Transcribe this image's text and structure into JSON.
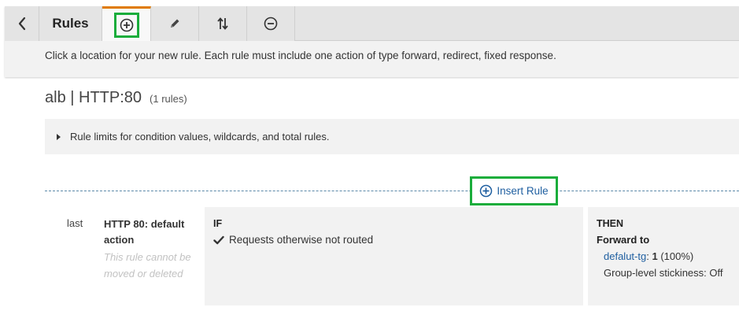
{
  "toolbar": {
    "title": "Rules",
    "icons": {
      "back": "chevron-left-icon",
      "add": "plus-circle-icon",
      "edit": "pencil-icon",
      "reorder": "sort-arrows-icon",
      "delete": "minus-circle-icon"
    },
    "hint": "Click a location for your new rule. Each rule must include one action of type forward, redirect, fixed response."
  },
  "listener": {
    "title": "alb | HTTP:80",
    "rule_count": "(1 rules)"
  },
  "limits": {
    "label": "Rule limits for condition values, wildcards, and total rules."
  },
  "insert": {
    "label": "Insert Rule"
  },
  "rule": {
    "order": "last",
    "name": "HTTP 80: default action",
    "note": "This rule cannot be moved or deleted",
    "if_label": "IF",
    "condition": "Requests otherwise not routed",
    "then_label": "THEN",
    "action": "Forward to",
    "target_group": "defalut-tg",
    "target_sep": ":",
    "weight": "1",
    "percent": "(100%)",
    "stickiness": "Group-level stickiness: Off"
  },
  "colors": {
    "accent_tab": "#e07b00",
    "highlight": "#1aad3b",
    "link": "#1f5fa0",
    "dashed_line": "#5b88a8"
  }
}
